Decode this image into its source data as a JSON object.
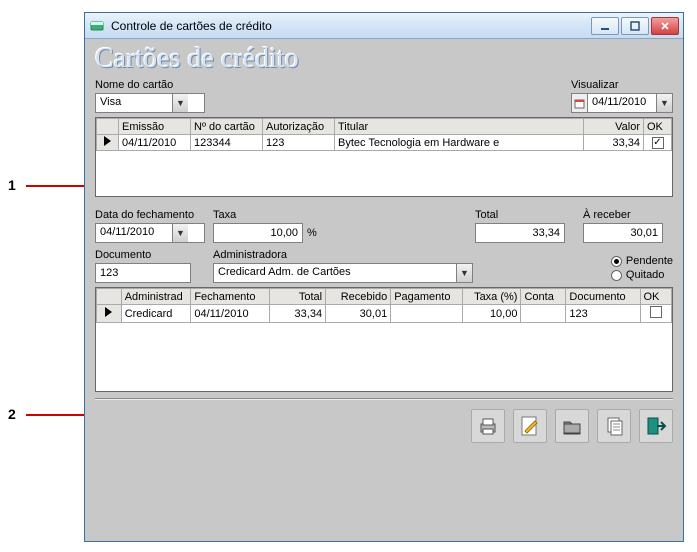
{
  "annotations": {
    "one": "1",
    "two": "2"
  },
  "window": {
    "title": "Controle de cartões de crédito"
  },
  "heading": "Cartões de crédito",
  "top": {
    "nome_label": "Nome do cartão",
    "nome_value": "Visa",
    "visualizar_label": "Visualizar",
    "visualizar_value": "04/11/2010"
  },
  "grid1": {
    "headers": {
      "emissao": "Emissão",
      "numero": "Nº do cartão",
      "autorizacao": "Autorização",
      "titular": "Titular",
      "valor": "Valor",
      "ok": "OK"
    },
    "row": {
      "emissao": "04/11/2010",
      "numero": "123344",
      "autorizacao": "123",
      "titular": "Bytec Tecnologia em Hardware e",
      "valor": "33,34",
      "ok": true
    }
  },
  "mid": {
    "fechamento_label": "Data do fechamento",
    "fechamento_value": "04/11/2010",
    "taxa_label": "Taxa",
    "taxa_value": "10,00",
    "taxa_unit": "%",
    "total_label": "Total",
    "total_value": "33,34",
    "receber_label": "À receber",
    "receber_value": "30,01",
    "documento_label": "Documento",
    "documento_value": "123",
    "admin_label": "Administradora",
    "admin_value": "Credicard Adm. de Cartões",
    "status_pendente": "Pendente",
    "status_quitado": "Quitado",
    "status_selected": "pendente"
  },
  "grid2": {
    "headers": {
      "administradora": "Administrad",
      "fechamento": "Fechamento",
      "total": "Total",
      "recebido": "Recebido",
      "pagamento": "Pagamento",
      "taxa": "Taxa (%)",
      "conta": "Conta",
      "documento": "Documento",
      "ok": "OK"
    },
    "row": {
      "administradora": "Credicard",
      "fechamento": "04/11/2010",
      "total": "33,34",
      "recebido": "30,01",
      "pagamento": "",
      "taxa": "10,00",
      "conta": "",
      "documento": "123",
      "ok": false
    }
  },
  "chart_data": {
    "type": "table",
    "tables": [
      {
        "name": "credit_card_transactions",
        "columns": [
          "Emissão",
          "Nº do cartão",
          "Autorização",
          "Titular",
          "Valor",
          "OK"
        ],
        "rows": [
          [
            "04/11/2010",
            "123344",
            "123",
            "Bytec Tecnologia em Hardware e",
            33.34,
            true
          ]
        ]
      },
      {
        "name": "administradora_payments",
        "columns": [
          "Administradora",
          "Fechamento",
          "Total",
          "Recebido",
          "Pagamento",
          "Taxa (%)",
          "Conta",
          "Documento",
          "OK"
        ],
        "rows": [
          [
            "Credicard",
            "04/11/2010",
            33.34,
            30.01,
            null,
            10.0,
            null,
            "123",
            false
          ]
        ]
      }
    ]
  }
}
